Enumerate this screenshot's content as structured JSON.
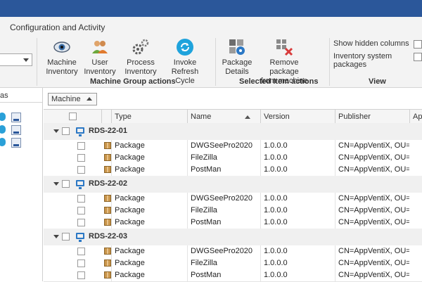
{
  "ribbon": {
    "tab_label": "Configuration and Activity",
    "machine_group": {
      "label": "Machine Group actions",
      "buttons": [
        {
          "line1": "Machine",
          "line2": "Inventory",
          "icon": "eye-icon"
        },
        {
          "line1": "User",
          "line2": "Inventory",
          "icon": "users-icon"
        },
        {
          "line1": "Process",
          "line2": "Inventory",
          "icon": "gears-icon"
        },
        {
          "line1": "Invoke",
          "line2": "Refresh Cycle",
          "icon": "refresh-icon"
        }
      ]
    },
    "selected_group": {
      "label": "Selected Item actions",
      "buttons": [
        {
          "line1": "Package",
          "line2": "Details",
          "icon": "package-details-icon"
        },
        {
          "line1": "Remove package",
          "line2": "from machine",
          "icon": "remove-package-icon"
        }
      ]
    },
    "view_group": {
      "label": "View",
      "show_hidden_columns": "Show hidden columns",
      "inventory_system_packages": "Inventory system packages"
    }
  },
  "left_panel": {
    "header_fragment": "as"
  },
  "grid": {
    "group_by": "Machine",
    "columns": {
      "type": "Type",
      "name": "Name",
      "version": "Version",
      "publisher": "Publisher",
      "app": "App"
    },
    "groups": [
      {
        "name": "RDS-22-01",
        "rows": [
          {
            "type": "Package",
            "name": "DWGSeePro2020",
            "version": "1.0.0.0",
            "publisher": "CN=AppVentiX, OU=..."
          },
          {
            "type": "Package",
            "name": "FileZilla",
            "version": "1.0.0.0",
            "publisher": "CN=AppVentiX, OU=..."
          },
          {
            "type": "Package",
            "name": "PostMan",
            "version": "1.0.0.0",
            "publisher": "CN=AppVentiX, OU=..."
          }
        ]
      },
      {
        "name": "RDS-22-02",
        "rows": [
          {
            "type": "Package",
            "name": "DWGSeePro2020",
            "version": "1.0.0.0",
            "publisher": "CN=AppVentiX, OU=..."
          },
          {
            "type": "Package",
            "name": "FileZilla",
            "version": "1.0.0.0",
            "publisher": "CN=AppVentiX, OU=..."
          },
          {
            "type": "Package",
            "name": "PostMan",
            "version": "1.0.0.0",
            "publisher": "CN=AppVentiX, OU=..."
          }
        ]
      },
      {
        "name": "RDS-22-03",
        "rows": [
          {
            "type": "Package",
            "name": "DWGSeePro2020",
            "version": "1.0.0.0",
            "publisher": "CN=AppVentiX, OU=..."
          },
          {
            "type": "Package",
            "name": "FileZilla",
            "version": "1.0.0.0",
            "publisher": "CN=AppVentiX, OU=..."
          },
          {
            "type": "Package",
            "name": "PostMan",
            "version": "1.0.0.0",
            "publisher": "CN=AppVentiX, OU=..."
          }
        ]
      }
    ]
  }
}
